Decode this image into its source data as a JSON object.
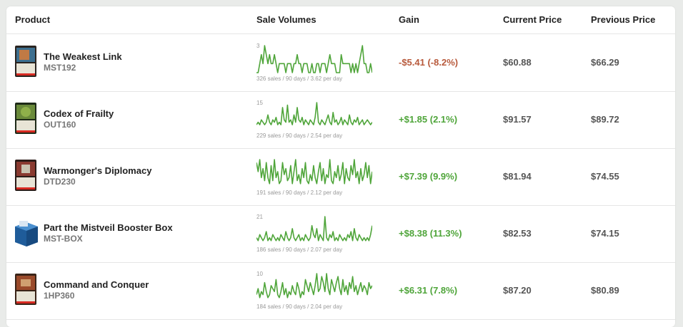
{
  "colors": {
    "accent_green": "#4fa53a",
    "negative": "#b85a3c"
  },
  "header": {
    "product": "Product",
    "sale_volumes": "Sale Volumes",
    "gain": "Gain",
    "current_price": "Current Price",
    "previous_price": "Previous Price"
  },
  "rows": [
    {
      "name": "The Weakest Link",
      "code": "MST192",
      "spark_max": "3",
      "spark": [
        0,
        0,
        1,
        2,
        1,
        3,
        2,
        1,
        2,
        1,
        1,
        2,
        1,
        0,
        1,
        1,
        1,
        1,
        0,
        1,
        1,
        1,
        0,
        1,
        1,
        2,
        1,
        1,
        0,
        1,
        1,
        1,
        0,
        0,
        1,
        0,
        0,
        1,
        1,
        0,
        1,
        1,
        1,
        0,
        1,
        2,
        1,
        1,
        1,
        0,
        0,
        0,
        2,
        1,
        1,
        1,
        1,
        1,
        0,
        1,
        0,
        1,
        0,
        1,
        2,
        3,
        1,
        1,
        0,
        0,
        1,
        0
      ],
      "caption": "326 sales / 90 days / 3.62 per day",
      "gain": "-$5.41 (-8.2%)",
      "gain_sign": "neg",
      "current": "$60.88",
      "previous": "$66.29"
    },
    {
      "name": "Codex of Frailty",
      "code": "OUT160",
      "spark_max": "15",
      "spark": [
        2,
        3,
        2,
        4,
        3,
        2,
        3,
        6,
        3,
        2,
        4,
        3,
        5,
        2,
        3,
        2,
        9,
        4,
        3,
        10,
        3,
        4,
        2,
        6,
        3,
        9,
        4,
        3,
        5,
        2,
        4,
        3,
        2,
        4,
        3,
        2,
        5,
        11,
        3,
        2,
        4,
        3,
        2,
        4,
        6,
        3,
        2,
        7,
        3,
        4,
        2,
        3,
        5,
        2,
        4,
        3,
        2,
        6,
        3,
        2,
        4,
        3,
        5,
        2,
        3,
        4,
        2,
        3,
        4,
        3,
        2,
        3
      ],
      "caption": "229 sales / 90 days / 2.54 per day",
      "gain": "+$1.85 (2.1%)",
      "gain_sign": "pos",
      "current": "$91.57",
      "previous": "$89.72"
    },
    {
      "name": "Warmonger's Diplomacy",
      "code": "DTD230",
      "spark_max": "",
      "spark": [
        8,
        5,
        9,
        3,
        6,
        2,
        8,
        3,
        1,
        7,
        2,
        9,
        3,
        5,
        1,
        2,
        8,
        4,
        6,
        2,
        3,
        7,
        1,
        5,
        9,
        2,
        4,
        1,
        6,
        3,
        8,
        2,
        1,
        4,
        2,
        7,
        3,
        1,
        5,
        8,
        2,
        6,
        1,
        4,
        3,
        9,
        2,
        1,
        5,
        3,
        7,
        2,
        4,
        8,
        1,
        6,
        3,
        2,
        7,
        4,
        9,
        3,
        5,
        1,
        6,
        2,
        4,
        8,
        3,
        7,
        1,
        5
      ],
      "caption": "191 sales / 90 days / 2.12 per day",
      "gain": "+$7.39 (9.9%)",
      "gain_sign": "pos",
      "current": "$81.94",
      "previous": "$74.55"
    },
    {
      "name": "Part the Mistveil Booster Box",
      "code": "MST-BOX",
      "spark_max": "21",
      "spark": [
        2,
        1,
        3,
        2,
        1,
        2,
        4,
        1,
        2,
        1,
        3,
        2,
        1,
        2,
        1,
        3,
        2,
        1,
        4,
        2,
        1,
        2,
        5,
        2,
        1,
        2,
        3,
        1,
        2,
        1,
        3,
        2,
        1,
        2,
        6,
        3,
        2,
        5,
        1,
        3,
        2,
        1,
        9,
        2,
        1,
        3,
        2,
        4,
        1,
        2,
        1,
        3,
        2,
        1,
        2,
        1,
        3,
        2,
        4,
        1,
        5,
        2,
        1,
        3,
        2,
        1,
        2,
        1,
        2,
        1,
        3,
        6
      ],
      "caption": "186 sales / 90 days / 2.07 per day",
      "gain": "+$8.38 (11.3%)",
      "gain_sign": "pos",
      "current": "$82.53",
      "previous": "$74.15"
    },
    {
      "name": "Command and Conquer",
      "code": "1HP360",
      "spark_max": "10",
      "spark": [
        2,
        4,
        1,
        3,
        2,
        6,
        3,
        1,
        2,
        5,
        4,
        3,
        7,
        2,
        1,
        3,
        6,
        2,
        4,
        1,
        3,
        2,
        5,
        3,
        2,
        6,
        4,
        1,
        3,
        2,
        7,
        5,
        3,
        6,
        4,
        2,
        5,
        9,
        3,
        4,
        8,
        6,
        3,
        9,
        4,
        2,
        7,
        5,
        3,
        6,
        8,
        4,
        2,
        7,
        3,
        5,
        2,
        6,
        4,
        8,
        3,
        5,
        2,
        4,
        6,
        3,
        5,
        4,
        2,
        6,
        4,
        5
      ],
      "caption": "184 sales / 90 days / 2.04 per day",
      "gain": "+$6.31 (7.8%)",
      "gain_sign": "pos",
      "current": "$87.20",
      "previous": "$80.89"
    }
  ]
}
